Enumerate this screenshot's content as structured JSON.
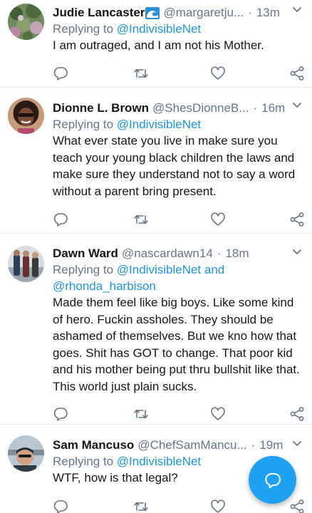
{
  "tweets": [
    {
      "name": "Judie Lancaster",
      "handle": "@margaretju...",
      "time": "13m",
      "replying_prefix": "Replying to ",
      "replying_to": "@IndivisibleNet",
      "replying_extra": "",
      "text": "I am outraged, and I am not his Mother."
    },
    {
      "name": "Dionne L. Brown",
      "handle": "@ShesDionneB...",
      "time": "16m",
      "replying_prefix": "Replying to ",
      "replying_to": "@IndivisibleNet",
      "replying_extra": "",
      "text": "What ever state you live in make sure you teach your young black children the laws and make sure they understand not to say a word without a parent bring present."
    },
    {
      "name": "Dawn Ward",
      "handle": "@nascardawn14",
      "time": "18m",
      "replying_prefix": "Replying to ",
      "replying_to": "@IndivisibleNet",
      "replying_and": " and",
      "replying_extra": "@rhonda_harbison",
      "text": "Made them feel like big boys. Like some kind of hero. Fuckin assholes. They should be ashamed of themselves. But we kno how that goes. Shit has GOT to change. That poor kid and his mother being put thru bullshit like that. This world just plain sucks."
    },
    {
      "name": "Sam Mancuso",
      "handle": "@ChefSamMancu...",
      "time": "19m",
      "replying_prefix": "Replying to ",
      "replying_to": "@IndivisibleNet",
      "replying_extra": "",
      "text": "WTF, how is that legal?"
    }
  ],
  "separator": "·",
  "icons": {
    "reply": "reply-icon",
    "retweet": "retweet-icon",
    "like": "like-icon",
    "share": "share-icon",
    "more": "chevron-down-icon",
    "compose": "compose-reply-icon"
  },
  "colors": {
    "link": "#1b95e0",
    "secondary": "#657786",
    "accent": "#1da1f2",
    "icon": "#657786"
  }
}
